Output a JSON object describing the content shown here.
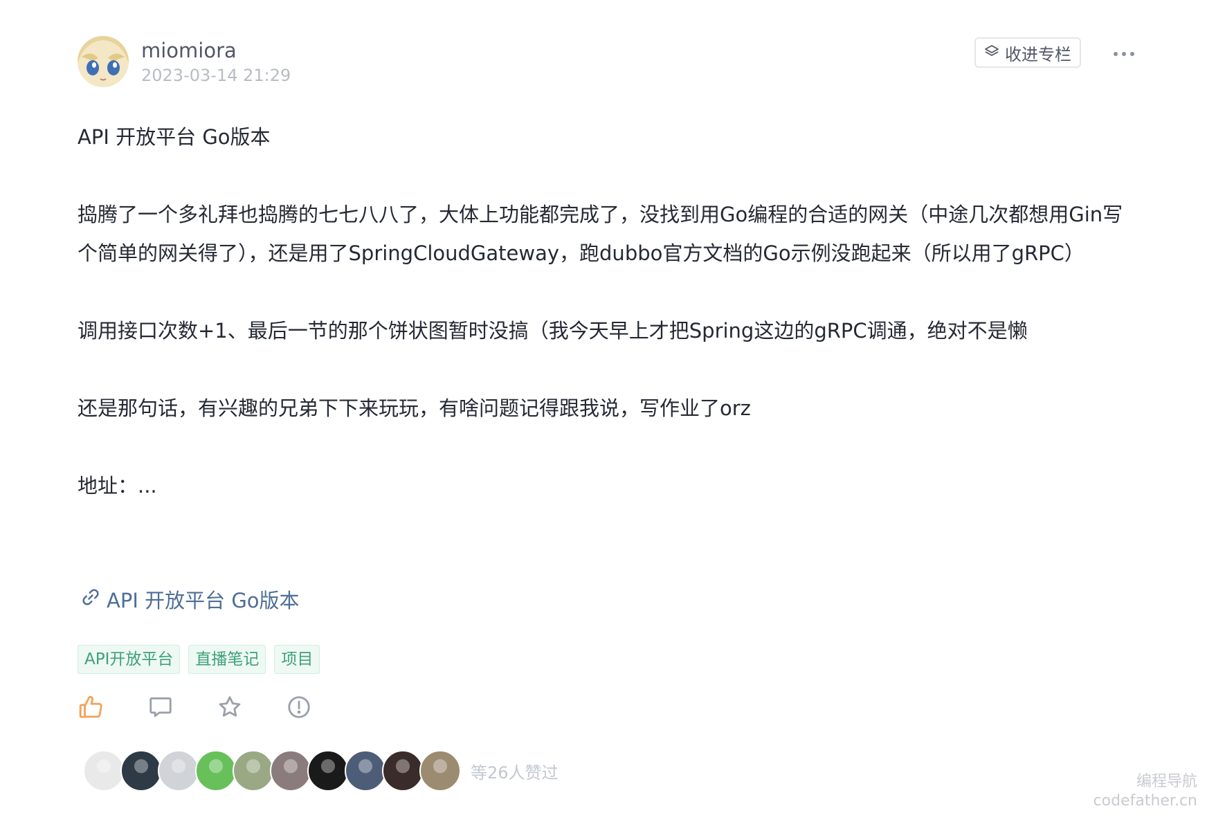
{
  "author": {
    "name": "miomiora",
    "time": "2023-03-14 21:29"
  },
  "collect_button": {
    "label": "收进专栏"
  },
  "content": {
    "title": "API 开放平台 Go版本",
    "paragraphs": [
      "捣腾了一个多礼拜也捣腾的七七八八了，大体上功能都完成了，没找到用Go编程的合适的网关（中途几次都想用Gin写个简单的网关得了），还是用了SpringCloudGateway，跑dubbo官方文档的Go示例没跑起来（所以用了gRPC）",
      "调用接口次数+1、最后一节的那个饼状图暂时没搞（我今天早上才把Spring这边的gRPC调通，绝对不是懒",
      "还是那句话，有兴趣的兄弟下下来玩玩，有啥问题记得跟我说，写作业了orz",
      "地址：..."
    ]
  },
  "link": {
    "label": "API 开放平台 Go版本"
  },
  "tags": [
    "API开放平台",
    "直播笔记",
    "项目"
  ],
  "likers": {
    "count_text": "等26人赞过",
    "avatar_colors": [
      "#e9e9e9",
      "#2e3a46",
      "#d0d3d8",
      "#67c05a",
      "#9aa884",
      "#8a7c7c",
      "#1a1a1a",
      "#4d5d78",
      "#3a2c2a",
      "#9b8b70"
    ]
  },
  "watermark": {
    "line1": "编程导航",
    "line2": "codefather.cn"
  }
}
